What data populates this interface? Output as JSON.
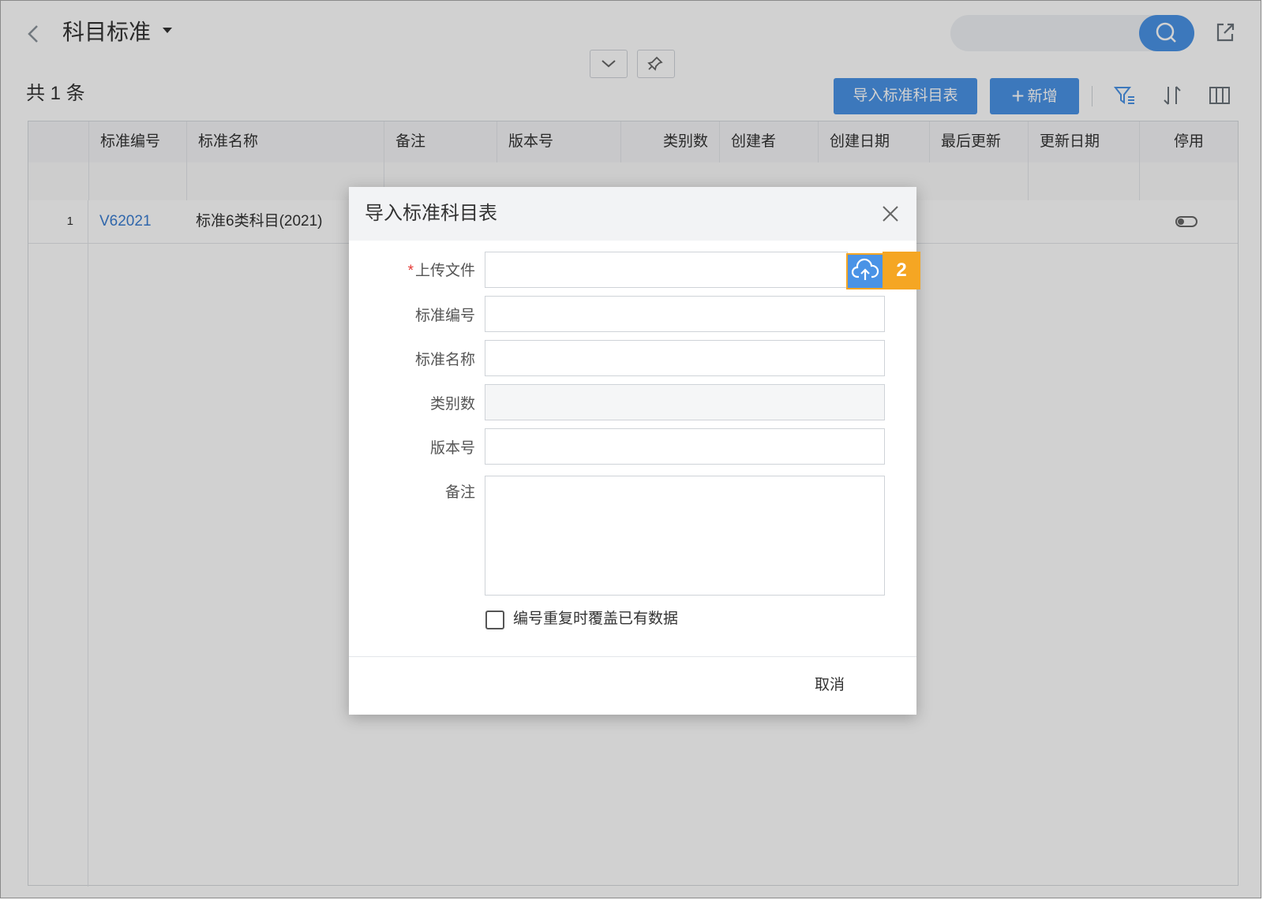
{
  "header": {
    "title": "科目标准"
  },
  "toolbar": {
    "count_label": "共 1 条",
    "import_button": "导入标准科目表",
    "add_button_plus": "+",
    "add_button": "新增"
  },
  "table": {
    "columns": [
      "标准编号",
      "标准名称",
      "备注",
      "版本号",
      "类别数",
      "创建者",
      "创建日期",
      "最后更新",
      "更新日期",
      "停用"
    ],
    "rows": [
      {
        "index": "1",
        "code": "V62021",
        "name": "标准6类科目(2021)"
      }
    ]
  },
  "dialog": {
    "title": "导入标准科目表",
    "required_mark": "*",
    "fields": {
      "upload": "上传文件",
      "code": "标准编号",
      "name": "标准名称",
      "category_count": "类别数",
      "version": "版本号",
      "remark": "备注"
    },
    "badge": "2",
    "overwrite_label": "编号重复时覆盖已有数据",
    "cancel": "取消"
  },
  "colors": {
    "accent": "#4a93e6",
    "badge": "#f5a623",
    "link": "#3a7dd1"
  }
}
